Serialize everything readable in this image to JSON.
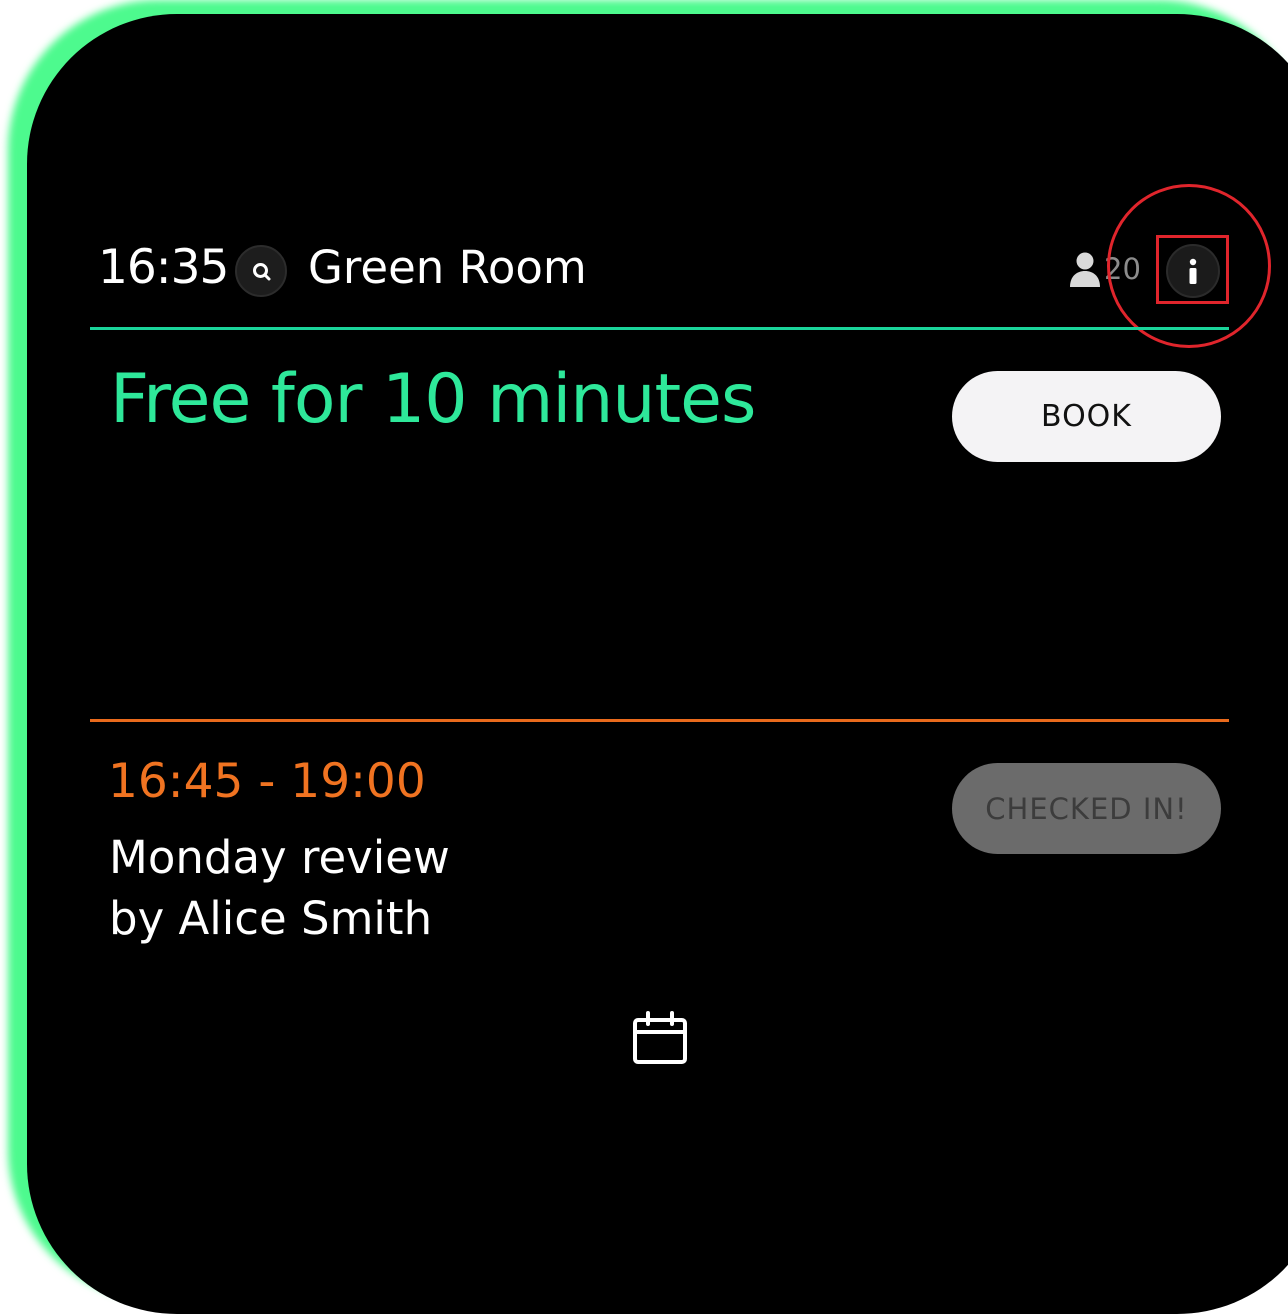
{
  "header": {
    "time": "16:35",
    "room_name": "Green Room",
    "capacity": "20",
    "icons": {
      "search": "search-icon",
      "capacity": "person-icon",
      "info": "info-icon"
    }
  },
  "status": {
    "text": "Free for 10 minutes",
    "book_label": "BOOK"
  },
  "next_meeting": {
    "time_range": "16:45 - 19:00",
    "title": "Monday review",
    "organizer": "by Alice Smith",
    "checkin_label": "CHECKED IN!"
  },
  "footer": {
    "icon": "calendar-icon"
  },
  "colors": {
    "glow": "#4dfa8e",
    "accent_green": "#2ee89a",
    "accent_orange": "#f07321",
    "highlight_red": "#e0252c"
  }
}
